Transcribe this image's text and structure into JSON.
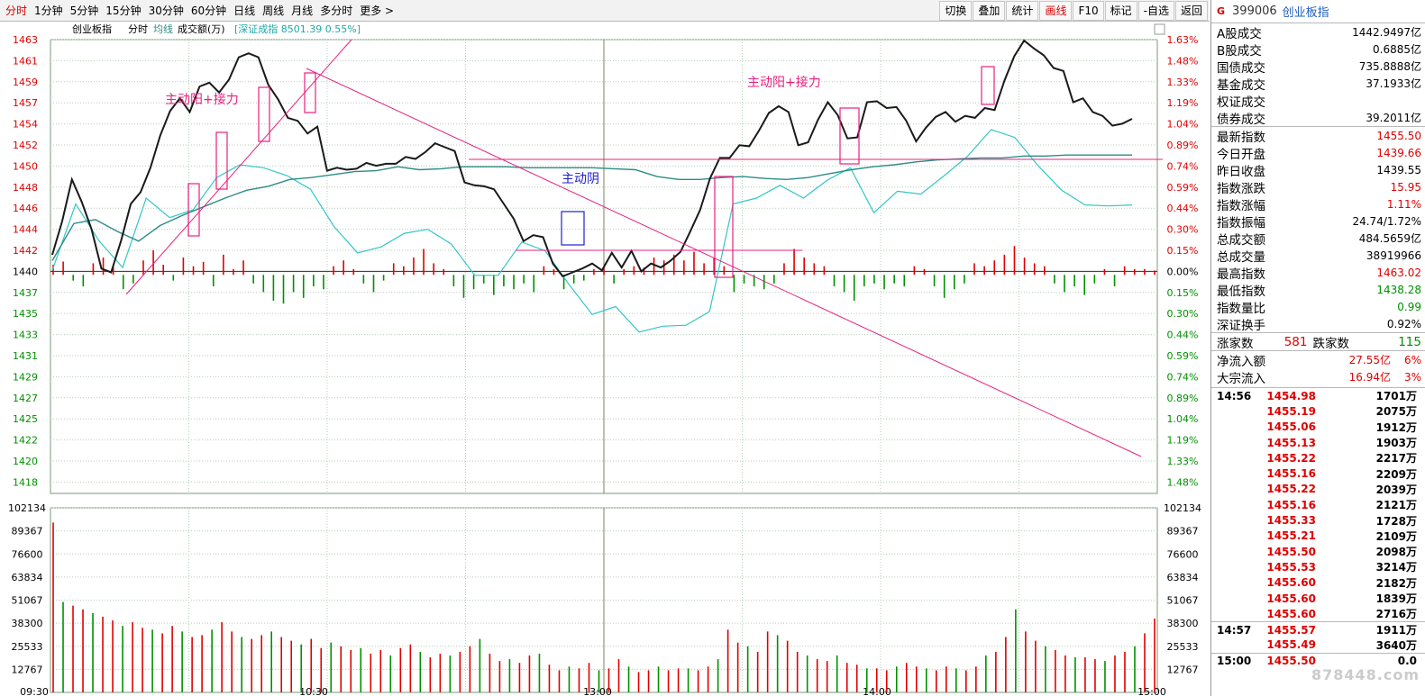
{
  "toolbar": {
    "tabs": [
      "分时",
      "1分钟",
      "5分钟",
      "15分钟",
      "30分钟",
      "60分钟",
      "日线",
      "周线",
      "月线",
      "多分时",
      "更多 >"
    ],
    "buttons": [
      "切换",
      "叠加",
      "统计",
      "画线",
      "F10",
      "标记",
      "-自选",
      "返回"
    ]
  },
  "legend": {
    "name": "创业板指",
    "mode": "分时",
    "avg": "均线",
    "volume": "成交额(万)",
    "overlay": "[深证成指 8501.39 0.55%]"
  },
  "colors": {
    "price": "#1a1a1a",
    "avg": "#2e8b87",
    "overlay": "#33c6c6",
    "up": "#e00000",
    "down": "#009000",
    "grid": "#9fbf9f",
    "draw": "#e8207f",
    "drawBlue": "#2020d0"
  },
  "annotations": [
    {
      "text": "主动阳+接力",
      "color": "#e8207f"
    },
    {
      "text": "主动阳+接力",
      "color": "#e8207f"
    },
    {
      "text": "主动阴",
      "color": "#2020d0"
    }
  ],
  "chart_data": {
    "type": "line",
    "title": "创业板指",
    "yaxis": {
      "ticks": [
        "1463",
        "1461",
        "1459",
        "1457",
        "1454",
        "1452",
        "1450",
        "1448",
        "1446",
        "1444",
        "1442",
        "1440",
        "1437",
        "1435",
        "1433",
        "1431",
        "1429",
        "1427",
        "1425",
        "1422",
        "1420",
        "1418"
      ],
      "right_ticks": [
        "1.63%",
        "1.48%",
        "1.33%",
        "1.19%",
        "1.04%",
        "0.89%",
        "0.74%",
        "0.59%",
        "0.44%",
        "0.30%",
        "0.15%",
        "0.00%",
        "0.15%",
        "0.30%",
        "0.44%",
        "0.59%",
        "0.74%",
        "0.89%",
        "1.04%",
        "1.19%",
        "1.33%",
        "1.48%"
      ],
      "base": 1439.55,
      "ylim": [
        1417.2,
        1463.6
      ]
    },
    "vol_axis": {
      "ticks": [
        "102134",
        "89367",
        "76600",
        "63834",
        "51067",
        "38300",
        "25533",
        "12767"
      ],
      "ylim": [
        0,
        102134
      ]
    },
    "xaxis": {
      "ticks": [
        "09:30",
        "10:30",
        "13:00",
        "14:00",
        "15:00"
      ],
      "minutes": 240
    },
    "price": [
      1441.6,
      1445,
      1449.3,
      1447,
      1444.2,
      1440.2,
      1439.8,
      1443,
      1446.8,
      1448,
      1450.5,
      1453.8,
      1456.3,
      1457.6,
      1456.2,
      1458.8,
      1459.2,
      1458.2,
      1459.5,
      1461.8,
      1462.2,
      1461.8,
      1459,
      1457.5,
      1455.6,
      1455.3,
      1454,
      1454.7,
      1450.2,
      1450.5,
      1450.3,
      1450.4,
      1451,
      1450.7,
      1450.9,
      1450.9,
      1451.6,
      1451.4,
      1452.1,
      1453,
      1452.6,
      1452.2,
      1449,
      1448.7,
      1448.6,
      1448.3,
      1446.8,
      1445.3,
      1443,
      1443.6,
      1443.4,
      1440.7,
      1439.4,
      1439.8,
      1440.2,
      1440.7,
      1440,
      1441.8,
      1440.3,
      1442,
      1439.9,
      1440.7,
      1440.3,
      1441,
      1441.9,
      1444,
      1446.2,
      1449.4,
      1451.5,
      1451.5,
      1452.8,
      1452.7,
      1454.3,
      1456.1,
      1456.8,
      1456.2,
      1452.8,
      1453.1,
      1455.4,
      1457.2,
      1455.9,
      1453.5,
      1453.6,
      1457.2,
      1457.3,
      1456.6,
      1456.7,
      1455.3,
      1453.2,
      1454.6,
      1455.7,
      1456.2,
      1455.2,
      1455.8,
      1455.6,
      1456.6,
      1456.4,
      1459.4,
      1461.9,
      1463.5,
      1462.7,
      1462,
      1460.7,
      1460.4,
      1457.2,
      1457.6,
      1456.2,
      1455.8,
      1454.8,
      1455,
      1455.5
    ],
    "avg": [
      1441,
      1444.8,
      1445.2,
      1444,
      1443,
      1444.6,
      1445.6,
      1446.5,
      1447.4,
      1448.2,
      1448.6,
      1449.3,
      1449.5,
      1449.8,
      1450.1,
      1450.2,
      1450.6,
      1450.3,
      1450.4,
      1450.6,
      1450.6,
      1450.6,
      1450.5,
      1450.5,
      1450.5,
      1450.5,
      1450.4,
      1450.3,
      1449.6,
      1449.3,
      1449.3,
      1449.5,
      1449.6,
      1449.4,
      1449.3,
      1449.5,
      1449.9,
      1450.3,
      1450.6,
      1450.8,
      1451.1,
      1451.3,
      1451.4,
      1451.5,
      1451.5,
      1451.7,
      1451.7,
      1451.8,
      1451.8,
      1451.8,
      1451.8
    ],
    "overlay": [
      1440,
      1446.8,
      1443,
      1440.3,
      1447.4,
      1445.4,
      1446.2,
      1449.5,
      1450.8,
      1450.5,
      1449.7,
      1448.3,
      1444.5,
      1441.8,
      1442.4,
      1443.8,
      1444.2,
      1442.7,
      1439.5,
      1439.5,
      1442.9,
      1442,
      1438.6,
      1435.5,
      1436.3,
      1433.7,
      1434.3,
      1434.4,
      1435.8,
      1446.8,
      1447.4,
      1448.7,
      1447.4,
      1449.2,
      1450.5,
      1445.9,
      1448.1,
      1447.8,
      1449.7,
      1451.7,
      1454.4,
      1453.6,
      1450.7,
      1448.2,
      1446.7,
      1446.6,
      1446.7
    ],
    "volume_bars": [
      0.92,
      0.49,
      0.47,
      0.45,
      0.43,
      0.41,
      0.39,
      0.36,
      0.38,
      0.35,
      0.34,
      0.32,
      0.36,
      0.33,
      0.3,
      0.31,
      0.34,
      0.38,
      0.33,
      0.3,
      0.29,
      0.31,
      0.33,
      0.3,
      0.28,
      0.26,
      0.29,
      0.24,
      0.27,
      0.25,
      0.23,
      0.24,
      0.21,
      0.23,
      0.2,
      0.24,
      0.26,
      0.22,
      0.19,
      0.21,
      0.2,
      0.22,
      0.25,
      0.29,
      0.21,
      0.17,
      0.18,
      0.16,
      0.2,
      0.21,
      0.15,
      0.12,
      0.14,
      0.13,
      0.16,
      0.12,
      0.13,
      0.18,
      0.14,
      0.11,
      0.12,
      0.14,
      0.12,
      0.13,
      0.13,
      0.12,
      0.14,
      0.18,
      0.34,
      0.27,
      0.25,
      0.22,
      0.33,
      0.31,
      0.28,
      0.22,
      0.2,
      0.18,
      0.17,
      0.2,
      0.16,
      0.15,
      0.13,
      0.13,
      0.12,
      0.14,
      0.16,
      0.14,
      0.13,
      0.12,
      0.14,
      0.13,
      0.12,
      0.14,
      0.2,
      0.22,
      0.3,
      0.45,
      0.33,
      0.28,
      0.25,
      0.23,
      0.2,
      0.19,
      0.19,
      0.18,
      0.17,
      0.2,
      0.22,
      0.25,
      0.32,
      0.4
    ],
    "flow_bars": [
      0.35,
      0.46,
      -0.2,
      -0.4,
      0.4,
      0.6,
      0.3,
      -0.5,
      -0.3,
      0.5,
      0.85,
      0.35,
      -0.2,
      0.6,
      0.3,
      0.45,
      -0.4,
      0.7,
      0.2,
      0.5,
      -0.3,
      -0.6,
      -0.9,
      -1.0,
      -0.6,
      -0.8,
      -0.4,
      -0.5,
      0.3,
      0.5,
      0.2,
      -0.3,
      -0.6,
      -0.2,
      0.4,
      0.3,
      0.6,
      0.9,
      0.4,
      0.2,
      -0.4,
      -0.8,
      -0.5,
      -0.3,
      -0.7,
      -0.4,
      -0.5,
      -0.3,
      -0.6,
      0.3,
      0.2,
      -0.5,
      -0.3,
      -0.2,
      0.2,
      0.3,
      -0.3,
      0.2,
      0.3,
      0.25,
      0.6,
      0.5,
      0.7,
      0.5,
      0.8,
      0.4,
      0.6,
      0.3,
      -0.6,
      -0.3,
      -0.4,
      -0.5,
      -0.3,
      0.4,
      0.9,
      0.6,
      0.4,
      0.3,
      -0.4,
      -0.6,
      -0.9,
      -0.4,
      -0.3,
      -0.5,
      -0.3,
      -0.4,
      0.3,
      0.2,
      -0.4,
      -0.8,
      -0.5,
      -0.3,
      0.4,
      0.3,
      0.5,
      0.7,
      1.0,
      0.6,
      0.4,
      0.3,
      -0.3,
      -0.6,
      -0.4,
      -0.7,
      -0.3,
      0.2,
      -0.4,
      0.3,
      0.2,
      0.2,
      0.15
    ]
  },
  "side": {
    "code": "399006",
    "name": "创业板指",
    "g": "G",
    "rows": [
      {
        "label": "A股成交",
        "value": "1442.9497亿",
        "color": "black"
      },
      {
        "label": "B股成交",
        "value": "0.6885亿",
        "color": "black"
      },
      {
        "label": "国债成交",
        "value": "735.8888亿",
        "color": "black"
      },
      {
        "label": "基金成交",
        "value": "37.1933亿",
        "color": "black"
      },
      {
        "label": "权证成交",
        "value": "",
        "color": "black"
      },
      {
        "label": "债券成交",
        "value": "39.2011亿",
        "color": "black"
      }
    ],
    "rows2": [
      {
        "label": "最新指数",
        "value": "1455.50",
        "color": "red"
      },
      {
        "label": "今日开盘",
        "value": "1439.66",
        "color": "red"
      },
      {
        "label": "昨日收盘",
        "value": "1439.55",
        "color": "black"
      },
      {
        "label": "指数涨跌",
        "value": "15.95",
        "color": "red"
      },
      {
        "label": "指数涨幅",
        "value": "1.11%",
        "color": "red"
      },
      {
        "label": "指数振幅",
        "value": "24.74/1.72%",
        "color": "black"
      },
      {
        "label": "总成交额",
        "value": "484.5659亿",
        "color": "black"
      },
      {
        "label": "总成交量",
        "value": "38919966",
        "color": "black"
      },
      {
        "label": "最高指数",
        "value": "1463.02",
        "color": "red"
      },
      {
        "label": "最低指数",
        "value": "1438.28",
        "color": "green"
      },
      {
        "label": "指数量比",
        "value": "0.99",
        "color": "green"
      },
      {
        "label": "深证换手",
        "value": "0.92%",
        "color": "black"
      }
    ],
    "breadth": {
      "up_label": "涨家数",
      "up": "581",
      "down_label": "跌家数",
      "down": "115"
    },
    "flows": [
      {
        "label": "净流入额",
        "value": "27.55亿",
        "pct": "6%"
      },
      {
        "label": "大宗流入",
        "value": "16.94亿",
        "pct": "3%"
      }
    ],
    "ticks": [
      {
        "time": "14:56",
        "price": "1454.98",
        "vol": "1701万"
      },
      {
        "time": "",
        "price": "1455.19",
        "vol": "2075万"
      },
      {
        "time": "",
        "price": "1455.06",
        "vol": "1912万"
      },
      {
        "time": "",
        "price": "1455.13",
        "vol": "1903万"
      },
      {
        "time": "",
        "price": "1455.22",
        "vol": "2217万"
      },
      {
        "time": "",
        "price": "1455.16",
        "vol": "2209万"
      },
      {
        "time": "",
        "price": "1455.22",
        "vol": "2039万"
      },
      {
        "time": "",
        "price": "1455.16",
        "vol": "2121万"
      },
      {
        "time": "",
        "price": "1455.33",
        "vol": "1728万"
      },
      {
        "time": "",
        "price": "1455.21",
        "vol": "2109万"
      },
      {
        "time": "",
        "price": "1455.50",
        "vol": "2098万"
      },
      {
        "time": "",
        "price": "1455.53",
        "vol": "3214万"
      },
      {
        "time": "",
        "price": "1455.60",
        "vol": "2182万"
      },
      {
        "time": "",
        "price": "1455.60",
        "vol": "1839万"
      },
      {
        "time": "",
        "price": "1455.60",
        "vol": "2716万"
      },
      {
        "time": "14:57",
        "price": "1455.57",
        "vol": "1911万"
      },
      {
        "time": "",
        "price": "1455.49",
        "vol": "3640万"
      },
      {
        "time": "15:00",
        "price": "1455.50",
        "vol": "0.0"
      }
    ],
    "watermark": "878448.com"
  }
}
